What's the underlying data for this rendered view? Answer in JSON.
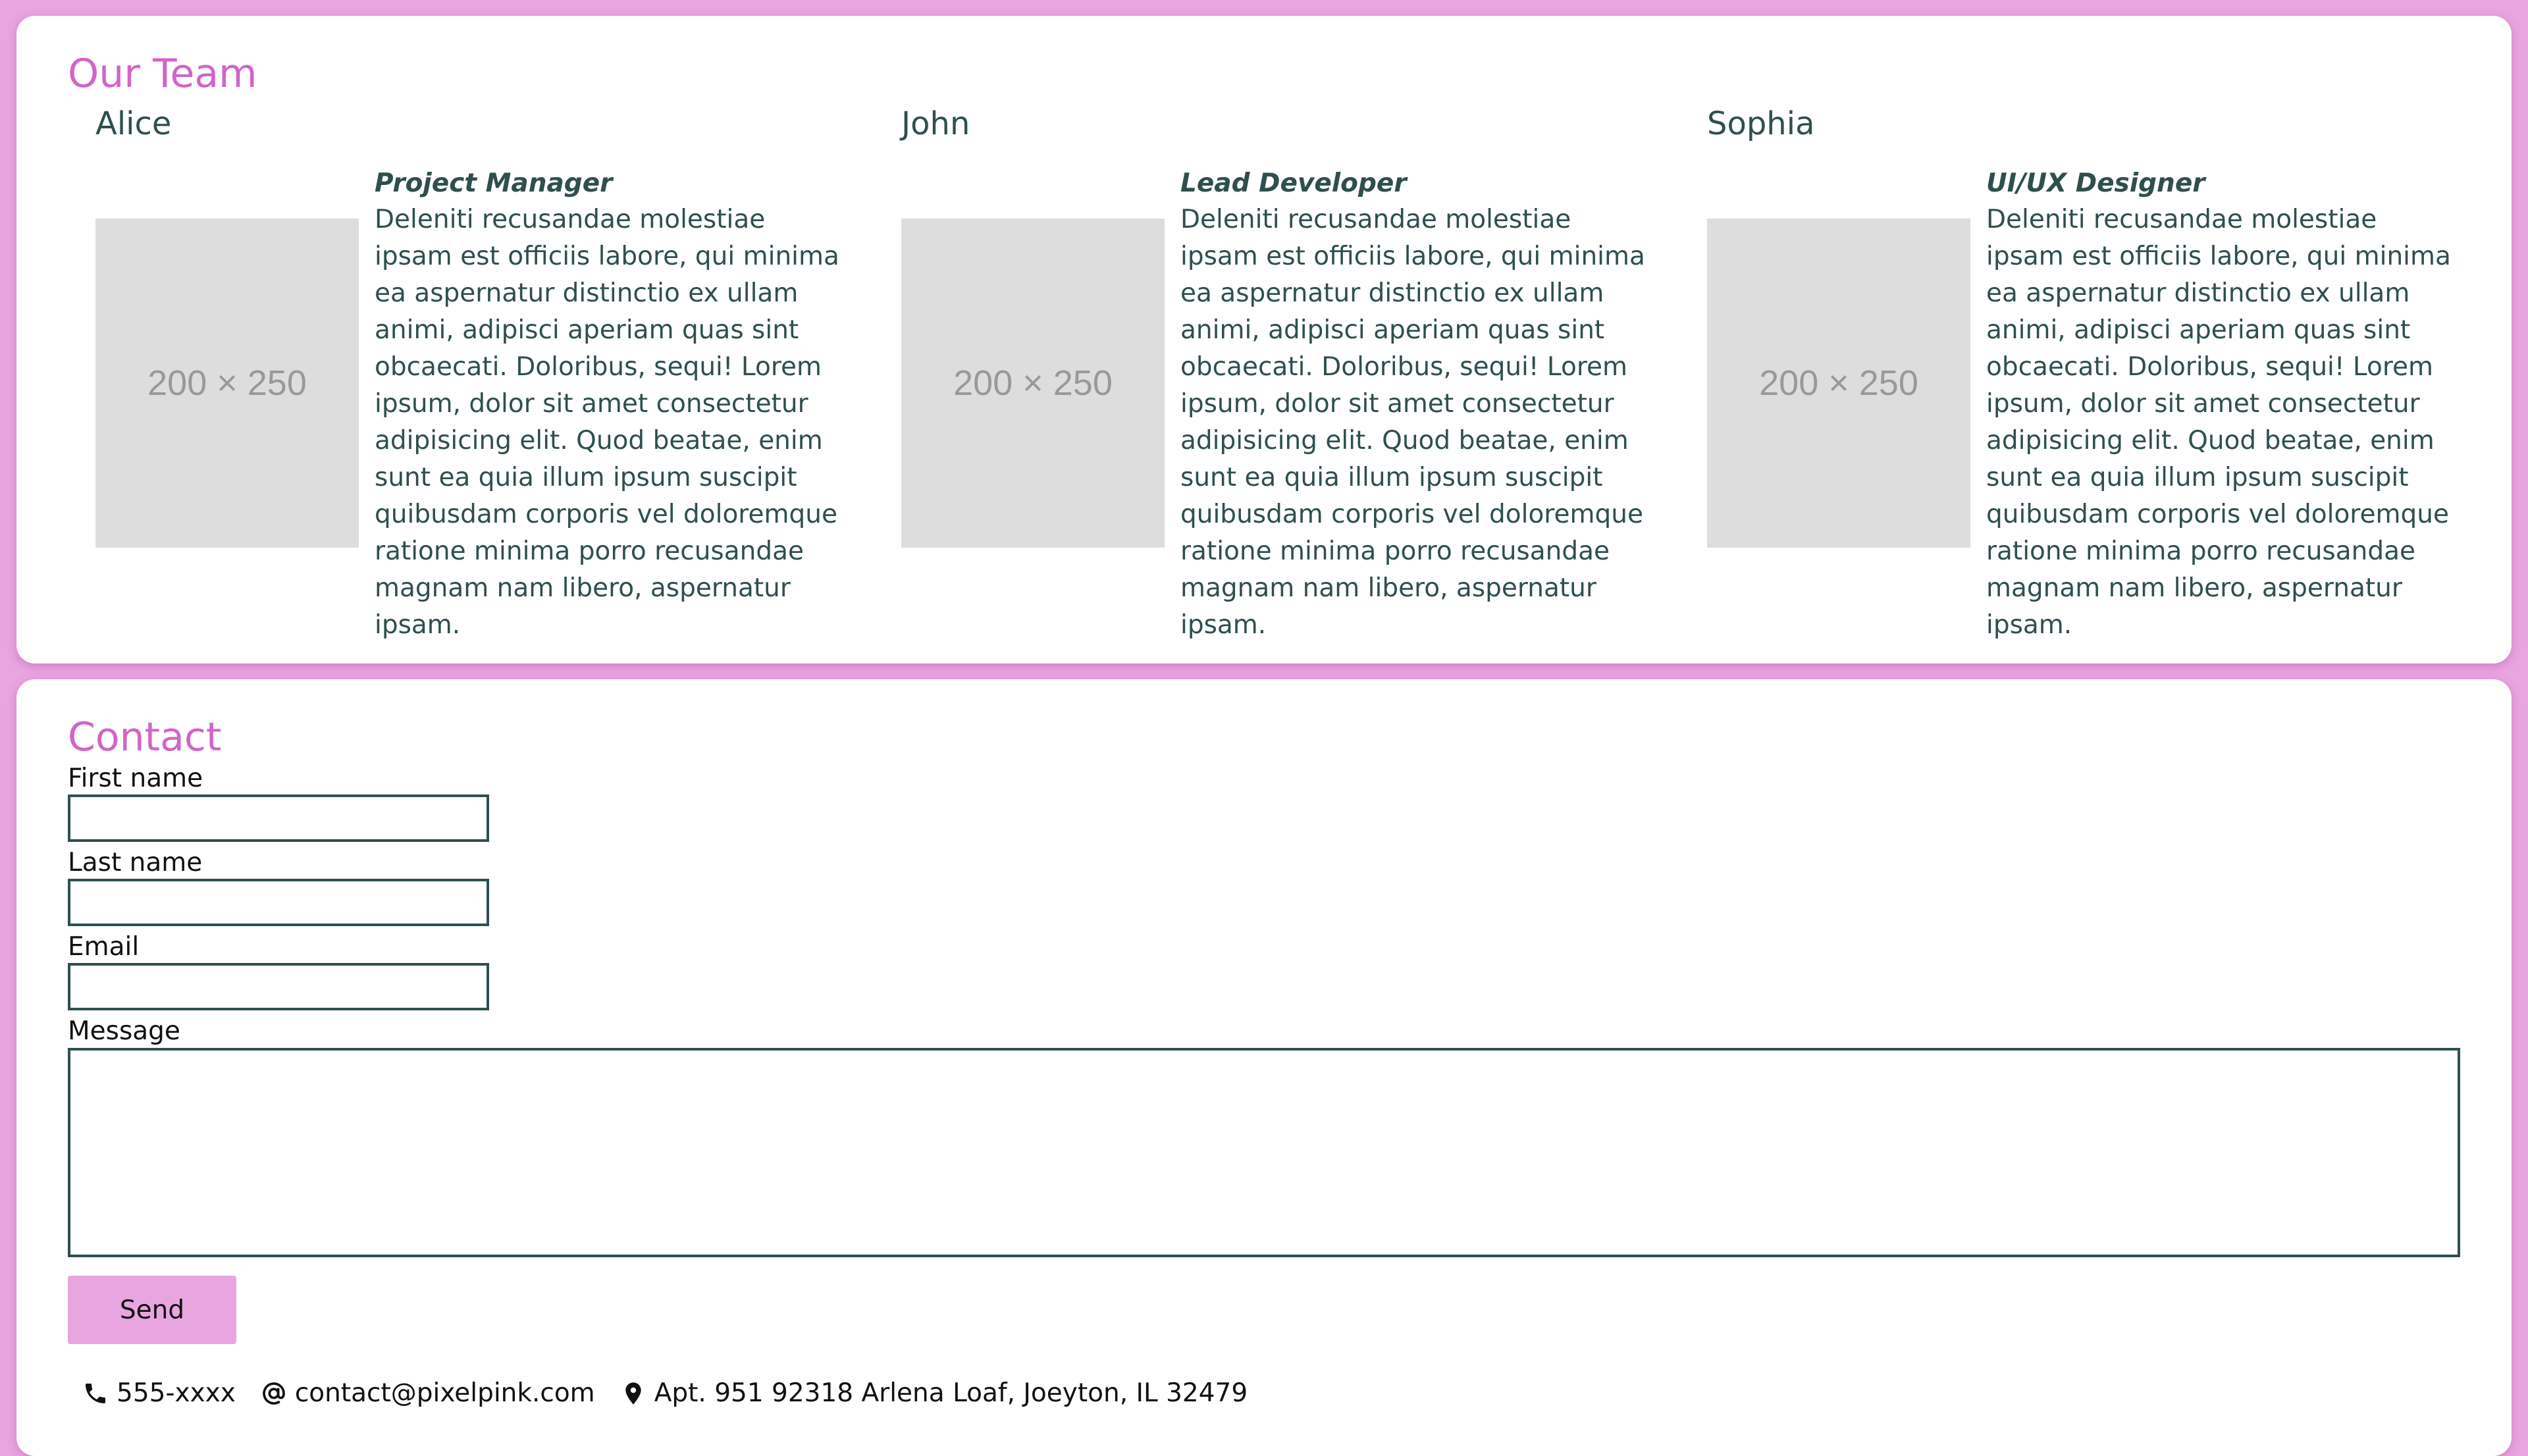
{
  "team": {
    "title": "Our Team",
    "members": [
      {
        "name": "Alice",
        "role": "Project Manager",
        "photo_label": "200 × 250",
        "bio": "Deleniti recusandae molestiae ipsam est officiis labore, qui minima ea aspernatur distinctio ex ullam animi, adipisci aperiam quas sint obcaecati. Doloribus, sequi! Lorem ipsum, dolor sit amet consectetur adipisicing elit. Quod beatae, enim sunt ea quia illum ipsum suscipit quibusdam corporis vel doloremque ratione minima porro recusandae magnam nam libero, aspernatur ipsam."
      },
      {
        "name": "John",
        "role": "Lead Developer",
        "photo_label": "200 × 250",
        "bio": "Deleniti recusandae molestiae ipsam est officiis labore, qui minima ea aspernatur distinctio ex ullam animi, adipisci aperiam quas sint obcaecati. Doloribus, sequi! Lorem ipsum, dolor sit amet consectetur adipisicing elit. Quod beatae, enim sunt ea quia illum ipsum suscipit quibusdam corporis vel doloremque ratione minima porro recusandae magnam nam libero, aspernatur ipsam."
      },
      {
        "name": "Sophia",
        "role": "UI/UX Designer",
        "photo_label": "200 × 250",
        "bio": "Deleniti recusandae molestiae ipsam est officiis labore, qui minima ea aspernatur distinctio ex ullam animi, adipisci aperiam quas sint obcaecati. Doloribus, sequi! Lorem ipsum, dolor sit amet consectetur adipisicing elit. Quod beatae, enim sunt ea quia illum ipsum suscipit quibusdam corporis vel doloremque ratione minima porro recusandae magnam nam libero, aspernatur ipsam."
      }
    ]
  },
  "contact": {
    "title": "Contact",
    "first_name_label": "First name",
    "first_name_value": "",
    "last_name_label": "Last name",
    "last_name_value": "",
    "email_label": "Email",
    "email_value": "",
    "message_label": "Message",
    "message_value": "",
    "send_label": "Send",
    "phone": "555-xxxx",
    "email_address": "contact@pixelpink.com",
    "address": "Apt. 951 92318 Arlena Loaf, Joeyton, IL 32479"
  },
  "icons": {
    "phone": "phone-icon",
    "at": "at-icon",
    "location": "location-pin-icon"
  },
  "colors": {
    "background": "#e8a5df",
    "heading": "#d264c8",
    "text": "#2f4f4f",
    "button": "#e8a5df",
    "card": "#ffffff"
  }
}
